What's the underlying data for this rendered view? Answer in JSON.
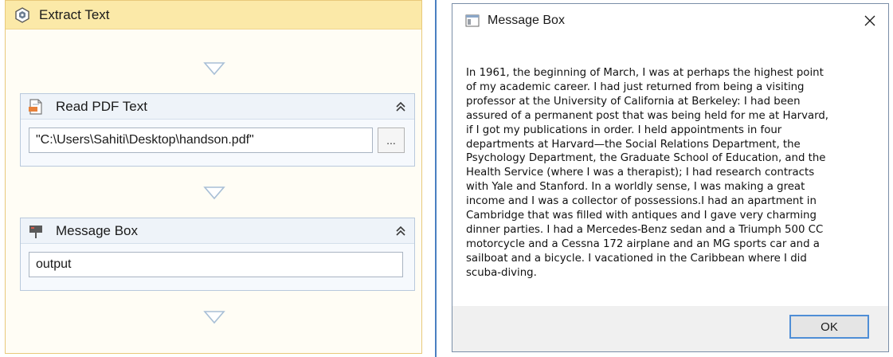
{
  "workflow": {
    "sequence_title": "Extract Text",
    "activities": [
      {
        "title": "Read PDF Text",
        "icon": "pdf-document-icon",
        "value": "\"C:\\Users\\Sahiti\\Desktop\\handson.pdf\"",
        "browse_label": "..."
      },
      {
        "title": "Message Box",
        "icon": "message-box-icon",
        "value": "output"
      }
    ],
    "colors": {
      "header": "#fbe9a8",
      "border": "#e8c97a",
      "activity_border": "#b9c9dc",
      "arrow": "#a8bfd6"
    }
  },
  "dialog": {
    "title": "Message Box",
    "message": "In 1961, the beginning of March, I was at perhaps the highest point\nof my academic career. I had just returned from being a visiting\nprofessor at the University of California at Berkeley: I had been\nassured of a permanent post that was being held for me at Harvard,\nif I got my publications in order. I held appointments in four\ndepartments at Harvard—the Social Relations Department, the\nPsychology Department, the Graduate School of Education, and the\nHealth Service (where I was a therapist); I had research contracts\nwith Yale and Stanford. In a worldly sense, I was making a great\nincome and I was a collector of possessions.I had an apartment in\nCambridge that was filled with antiques and I gave very charming\ndinner parties. I had a Mercedes-Benz sedan and a Triumph 500 CC\nmotorcycle and a Cessna 172 airplane and an MG sports car and a\nsailboat and a bicycle. I vacationed in the Caribbean where I did\nscuba-diving.",
    "ok_label": "OK",
    "colors": {
      "ok_border": "#4f8ed6",
      "divider": "#4a7fc1"
    }
  }
}
